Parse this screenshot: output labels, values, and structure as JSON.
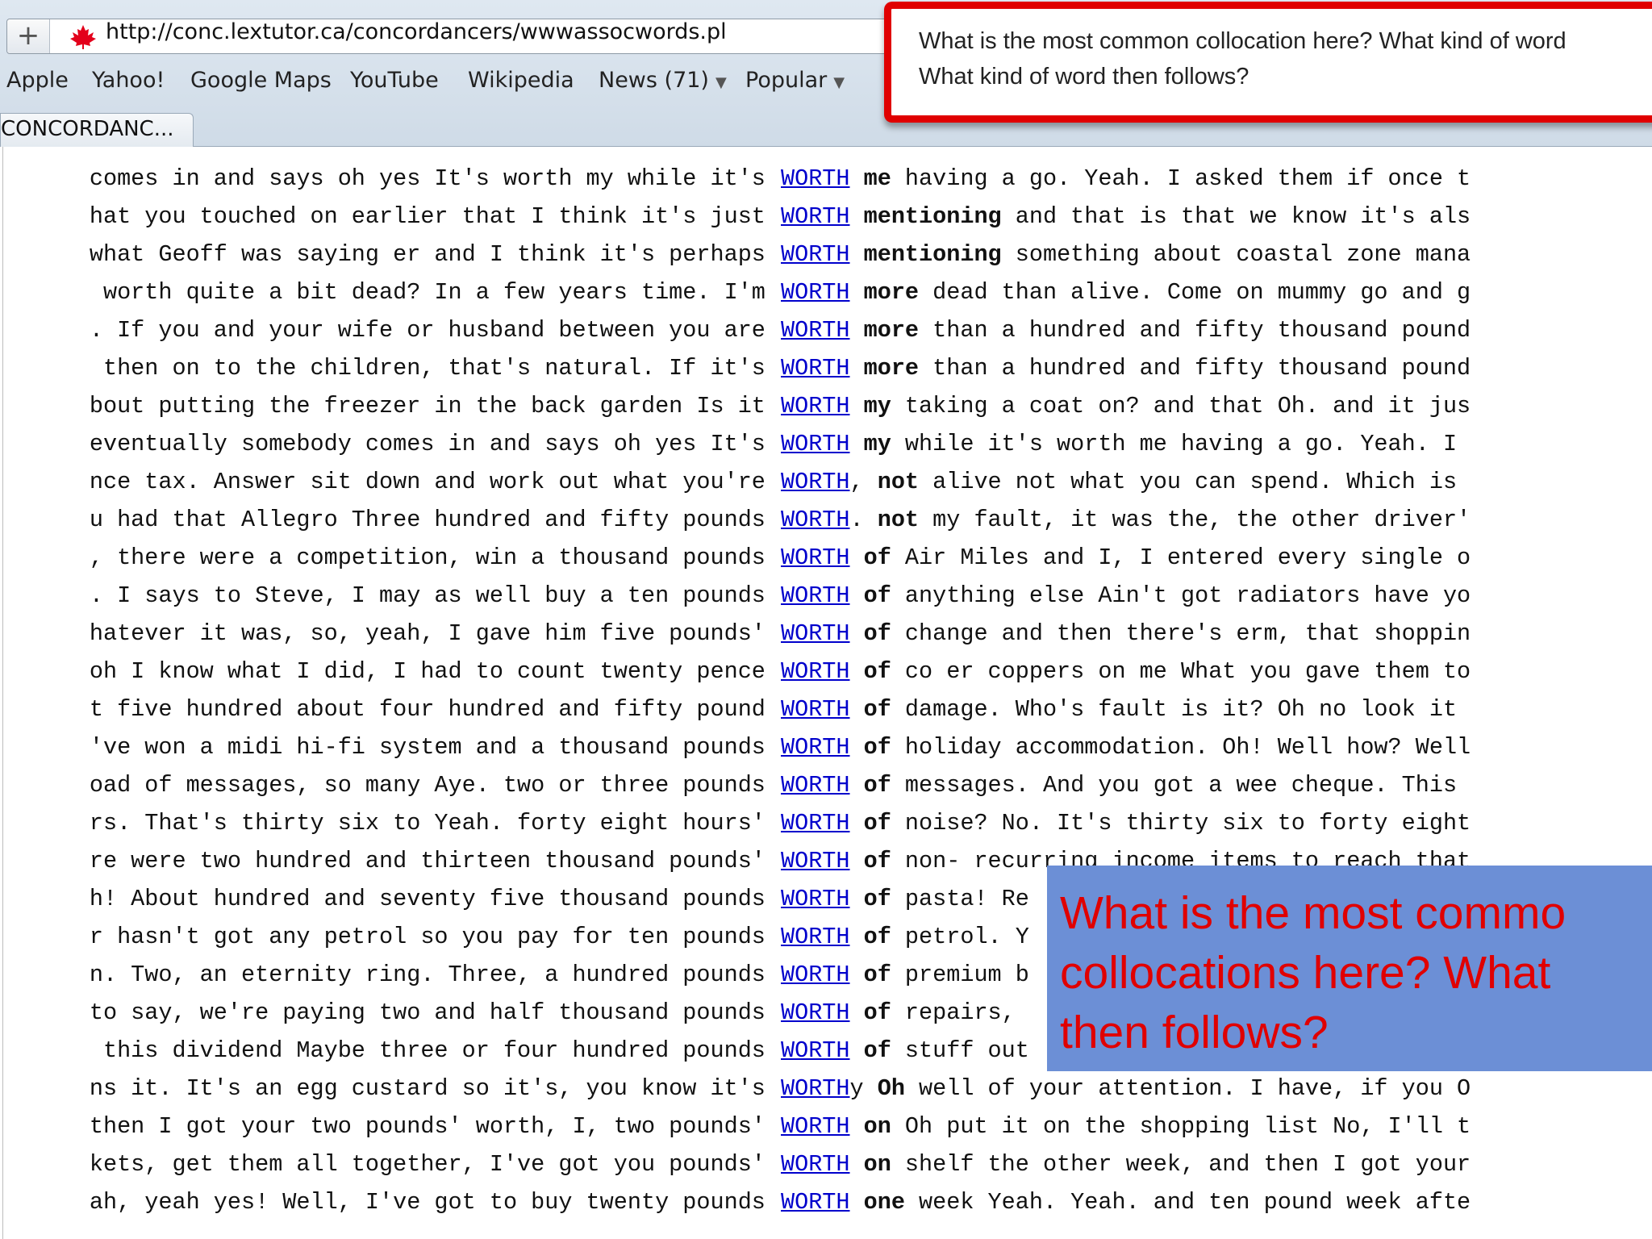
{
  "browser": {
    "url": "http://conc.lextutor.ca/concordancers/wwwassocwords.pl",
    "plus_label": "+",
    "bookmarks": [
      "Apple",
      "Yahoo!",
      "Google Maps",
      "YouTube",
      "Wikipedia",
      "News (71)",
      "Popular"
    ],
    "tab_title": "CONCORDANC..."
  },
  "callout_top": {
    "text": "What is the most common collocation here? What kind of word\nWhat kind of word then follows?"
  },
  "callout_blue": {
    "text": "What is the most commo\ncollocations here? What\nthen follows?"
  },
  "colors": {
    "keyword": "#0000cc",
    "callout_border": "#e00000",
    "callout_blue": "#6c8fd6",
    "callout_text": "#e00000"
  },
  "concordance": {
    "lines": [
      {
        "left": "comes in and says oh yes It's worth my while it's ",
        "kw": "WORTH",
        "after": "",
        "right": " me",
        "rest": " having a go. Yeah. I asked them if once t"
      },
      {
        "left": "hat you touched on earlier that I think it's just ",
        "kw": "WORTH",
        "after": "",
        "right": " mentioning",
        "rest": " and that is that we know it's als"
      },
      {
        "left": "what Geoff was saying er and I think it's perhaps ",
        "kw": "WORTH",
        "after": "",
        "right": " mentioning",
        "rest": " something about coastal zone mana"
      },
      {
        "left": " worth quite a bit dead? In a few years time. I'm ",
        "kw": "WORTH",
        "after": "",
        "right": " more",
        "rest": " dead than alive. Come on mummy go and g"
      },
      {
        "left": ". If you and your wife or husband between you are ",
        "kw": "WORTH",
        "after": "",
        "right": " more",
        "rest": " than a hundred and fifty thousand pound"
      },
      {
        "left": " then on to the children, that's natural. If it's ",
        "kw": "WORTH",
        "after": "",
        "right": " more",
        "rest": " than a hundred and fifty thousand pound"
      },
      {
        "left": "bout putting the freezer in the back garden Is it ",
        "kw": "WORTH",
        "after": "",
        "right": " my",
        "rest": " taking a coat on? and that Oh. and it jus"
      },
      {
        "left": "eventually somebody comes in and says oh yes It's ",
        "kw": "WORTH",
        "after": "",
        "right": " my",
        "rest": " while it's worth me having a go. Yeah. I"
      },
      {
        "left": "nce tax. Answer sit down and work out what you're ",
        "kw": "WORTH",
        "after": ",",
        "right": " not",
        "rest": " alive not what you can spend. Which is"
      },
      {
        "left": "u had that Allegro Three hundred and fifty pounds ",
        "kw": "WORTH",
        "after": ".",
        "right": " not",
        "rest": " my fault, it was the, the other driver'"
      },
      {
        "left": ", there were a competition, win a thousand pounds ",
        "kw": "WORTH",
        "after": "",
        "right": " of",
        "rest": " Air Miles and I, I entered every single o"
      },
      {
        "left": ". I says to Steve, I may as well buy a ten pounds ",
        "kw": "WORTH",
        "after": "",
        "right": " of",
        "rest": " anything else Ain't got radiators have yo"
      },
      {
        "left": "hatever it was, so, yeah, I gave him five pounds' ",
        "kw": "WORTH",
        "after": "",
        "right": " of",
        "rest": " change and then there's erm, that shoppin"
      },
      {
        "left": "oh I know what I did, I had to count twenty pence ",
        "kw": "WORTH",
        "after": "",
        "right": " of",
        "rest": " co er coppers on me What you gave them to"
      },
      {
        "left": "t five hundred about four hundred and fifty pound ",
        "kw": "WORTH",
        "after": "",
        "right": " of",
        "rest": " damage. Who's fault is it? Oh no look it"
      },
      {
        "left": "'ve won a midi hi-fi system and a thousand pounds ",
        "kw": "WORTH",
        "after": "",
        "right": " of",
        "rest": " holiday accommodation. Oh! Well how? Well"
      },
      {
        "left": "oad of messages, so many Aye. two or three pounds ",
        "kw": "WORTH",
        "after": "",
        "right": " of",
        "rest": " messages. And you got a wee cheque. This"
      },
      {
        "left": "rs. That's thirty six to Yeah. forty eight hours' ",
        "kw": "WORTH",
        "after": "",
        "right": " of",
        "rest": " noise? No. It's thirty six to forty eight"
      },
      {
        "left": "re were two hundred and thirteen thousand pounds' ",
        "kw": "WORTH",
        "after": "",
        "right": " of",
        "rest": " non- recurring income items to reach that"
      },
      {
        "left": "h! About hundred and seventy five thousand pounds ",
        "kw": "WORTH",
        "after": "",
        "right": " of",
        "rest": " pasta! Re"
      },
      {
        "left": "r hasn't got any petrol so you pay for ten pounds ",
        "kw": "WORTH",
        "after": "",
        "right": " of",
        "rest": " petrol. Y"
      },
      {
        "left": "n. Two, an eternity ring. Three, a hundred pounds ",
        "kw": "WORTH",
        "after": "",
        "right": " of",
        "rest": " premium b"
      },
      {
        "left": "to say, we're paying two and half thousand pounds ",
        "kw": "WORTH",
        "after": "",
        "right": " of",
        "rest": " repairs,"
      },
      {
        "left": " this dividend Maybe three or four hundred pounds ",
        "kw": "WORTH",
        "after": "",
        "right": " of",
        "rest": " stuff out"
      },
      {
        "left": "ns it. It's an egg custard so it's, you know it's ",
        "kw": "WORTH",
        "after": "y",
        "right": " Oh",
        "rest": " well of your attention. I have, if you O"
      },
      {
        "left": "then I got your two pounds' worth, I, two pounds' ",
        "kw": "WORTH",
        "after": "",
        "right": " on",
        "rest": " Oh put it on the shopping list No, I'll t"
      },
      {
        "left": "kets, get them all together, I've got you pounds' ",
        "kw": "WORTH",
        "after": "",
        "right": " on",
        "rest": " shelf the other week, and then I got your"
      },
      {
        "left": "ah, yeah yes! Well, I've got to buy twenty pounds ",
        "kw": "WORTH",
        "after": "",
        "right": " one",
        "rest": " week Yeah. Yeah. and ten pound week afte"
      }
    ]
  }
}
